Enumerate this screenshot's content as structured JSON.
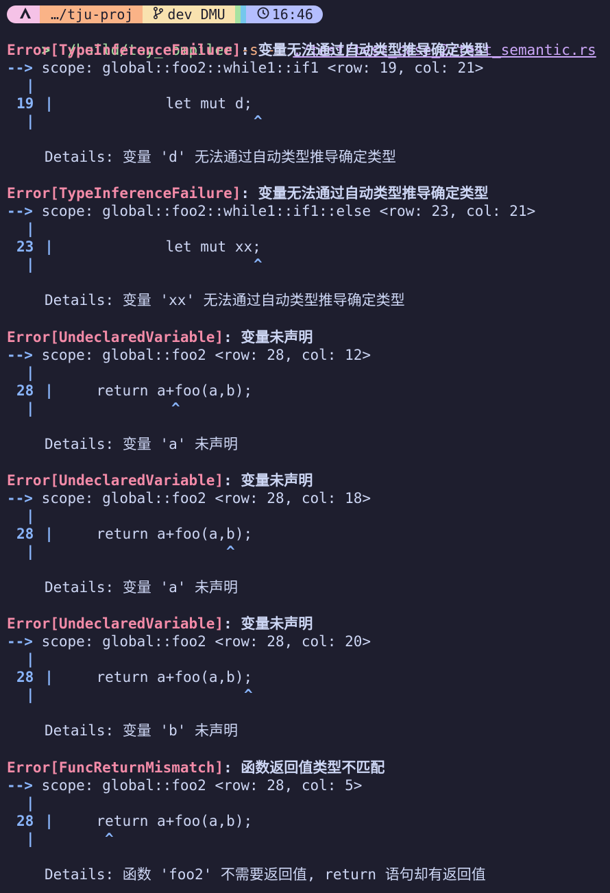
{
  "prompt": {
    "os_icon": "arch-logo-icon",
    "dir": "…/tju-proj",
    "branch_icon": "git-branch-icon",
    "branch": "dev DMU",
    "clock_icon": "clock-icon",
    "time": "16:46"
  },
  "command": {
    "prompt_char": ">",
    "program": "./build/toy_compiler",
    "flags": "-s -i",
    "file": "./test/test_case_2/test_semantic.rs"
  },
  "errors": [
    {
      "tag": "Error[TypeInferenceFailure]",
      "msg": ": 变量无法通过自动类型推导确定类型",
      "arrow": "-->",
      "scope": " scope: global::foo2::while1::if1 <row: 19, col: 21>",
      "pipe": "|",
      "row": "19",
      "code": "            let mut d;",
      "caret": "^",
      "details": "Details: 变量 'd' 无法通过自动类型推导确定类型"
    },
    {
      "tag": "Error[TypeInferenceFailure]",
      "msg": ": 变量无法通过自动类型推导确定类型",
      "arrow": "-->",
      "scope": " scope: global::foo2::while1::if1::else <row: 23, col: 21>",
      "pipe": "|",
      "row": "23",
      "code": "            let mut xx;",
      "caret": "^",
      "details": "Details: 变量 'xx' 无法通过自动类型推导确定类型"
    },
    {
      "tag": "Error[UndeclaredVariable]",
      "msg": ": 变量未声明",
      "arrow": "-->",
      "scope": " scope: global::foo2 <row: 28, col: 12>",
      "pipe": "|",
      "row": "28",
      "code": "    return a+foo(a,b);",
      "caret": "^",
      "details": "Details: 变量 'a' 未声明"
    },
    {
      "tag": "Error[UndeclaredVariable]",
      "msg": ": 变量未声明",
      "arrow": "-->",
      "scope": " scope: global::foo2 <row: 28, col: 18>",
      "pipe": "|",
      "row": "28",
      "code": "    return a+foo(a,b);",
      "caret": "^",
      "details": "Details: 变量 'a' 未声明"
    },
    {
      "tag": "Error[UndeclaredVariable]",
      "msg": ": 变量未声明",
      "arrow": "-->",
      "scope": " scope: global::foo2 <row: 28, col: 20>",
      "pipe": "|",
      "row": "28",
      "code": "    return a+foo(a,b);",
      "caret": "^",
      "details": "Details: 变量 'b' 未声明"
    },
    {
      "tag": "Error[FuncReturnMismatch]",
      "msg": ": 函数返回值类型不匹配",
      "arrow": "-->",
      "scope": " scope: global::foo2 <row: 28, col: 5>",
      "pipe": "|",
      "row": "28",
      "code": "    return a+foo(a,b);",
      "caret": "^",
      "details": "Details: 函数 'foo2' 不需要返回值, return 语句却有返回值"
    }
  ],
  "colors": {
    "background": "#1e1e2e",
    "error": "#f38ba8",
    "accent_blue": "#89b4fa",
    "command_green": "#a6e3a1",
    "path_purple": "#cba6f7"
  }
}
